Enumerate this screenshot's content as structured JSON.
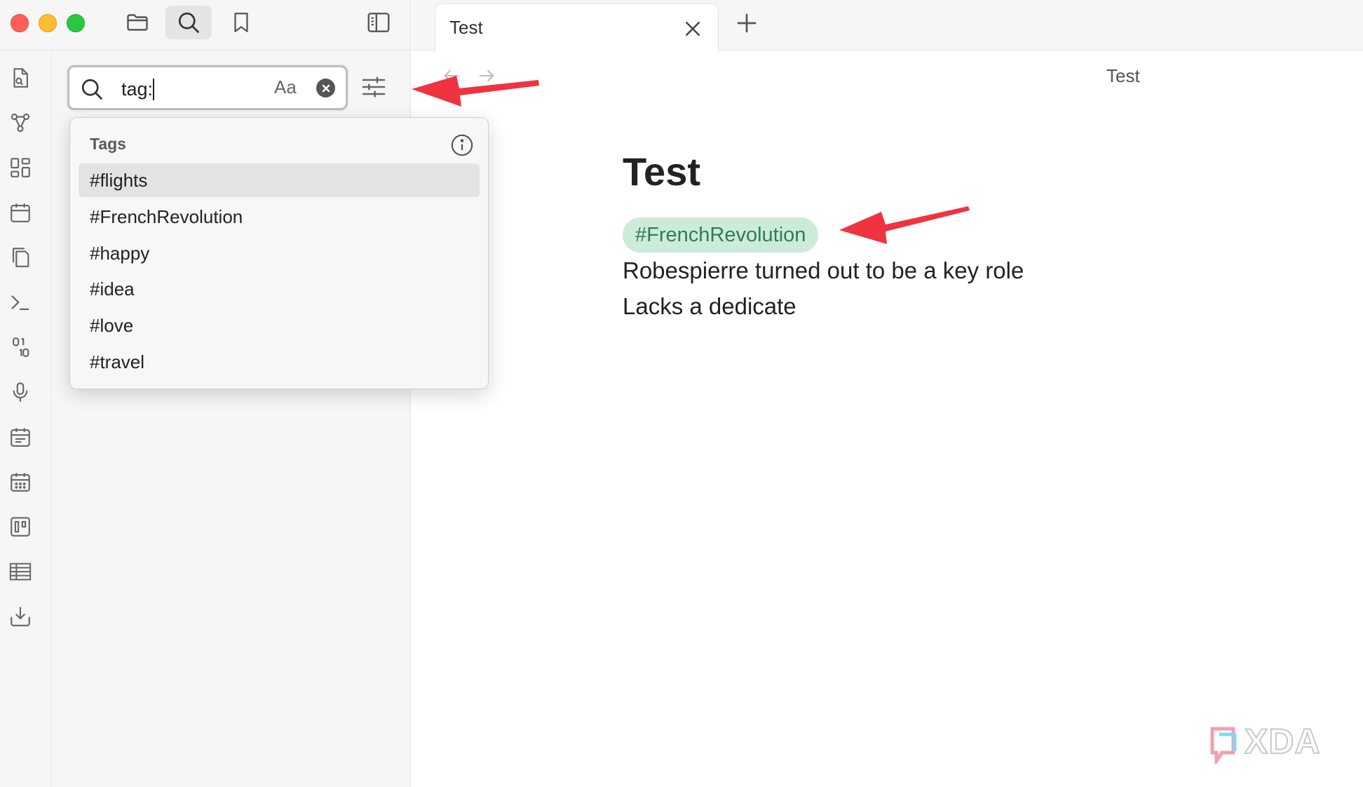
{
  "sidebar": {
    "search": {
      "value": "tag:",
      "match_case_label": "Aa"
    },
    "dropdown": {
      "header": "Tags",
      "items": [
        "#flights",
        "#FrenchRevolution",
        "#happy",
        "#idea",
        "#love",
        "#travel"
      ]
    }
  },
  "tabs": [
    {
      "label": "Test"
    }
  ],
  "view": {
    "title": "Test"
  },
  "note": {
    "title": "Test",
    "tag": "#FrenchRevolution",
    "lines": [
      "Robespierre turned out to be a key role",
      "Lacks a dedicate"
    ]
  },
  "watermark": {
    "text": "XDA"
  },
  "colors": {
    "accent_red_arrow": "#ef3340",
    "tag_background": "#cdebd9",
    "tag_text": "#2e7d55",
    "traffic_red": "#fe5f57",
    "traffic_yellow": "#febc2e",
    "traffic_green": "#28c840"
  },
  "icons": {
    "titlebar": [
      "folder-icon",
      "search-icon",
      "bookmark-icon",
      "sidebar-toggle-icon"
    ],
    "ribbon": [
      "quick-switcher-icon",
      "graph-view-icon",
      "canvas-icon",
      "daily-note-icon",
      "templates-icon",
      "command-palette-icon",
      "random-note-icon",
      "audio-recorder-icon",
      "calendar-icon",
      "calendar-grid-icon",
      "kanban-icon",
      "table-icon",
      "import-icon"
    ]
  }
}
